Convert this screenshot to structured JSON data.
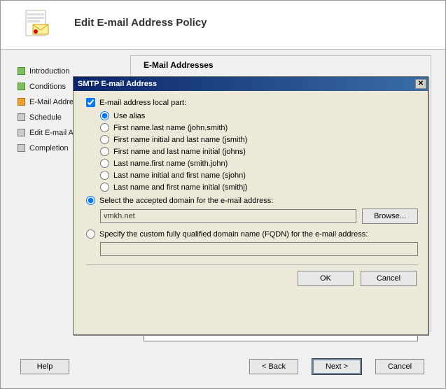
{
  "wizard": {
    "title": "Edit E-mail Address Policy",
    "section_title": "E-Mail Addresses",
    "steps": [
      {
        "label": "Introduction",
        "status": "green"
      },
      {
        "label": "Conditions",
        "status": "green"
      },
      {
        "label": "E-Mail Addresses",
        "status": "orange"
      },
      {
        "label": "Schedule",
        "status": "grey"
      },
      {
        "label": "Edit E-mail Address Policy",
        "status": "grey"
      },
      {
        "label": "Completion",
        "status": "grey"
      }
    ],
    "buttons": {
      "help": "Help",
      "back": "< Back",
      "next": "Next >",
      "cancel": "Cancel"
    }
  },
  "dialog": {
    "title": "SMTP E-mail Address",
    "checkbox_label": "E-mail address local part:",
    "checkbox_checked": true,
    "local_part_options": [
      "Use alias",
      "First name.last name (john.smith)",
      "First name initial and last name (jsmith)",
      "First name and last name initial (johns)",
      "Last name.first name (smith.john)",
      "Last name initial and first name (sjohn)",
      "Last name and first name initial (smithj)"
    ],
    "local_part_selected_index": 0,
    "domain_mode_selected": "accepted",
    "accepted_label": "Select the accepted domain for the e-mail address:",
    "accepted_value": "vmkh.net",
    "browse_label": "Browse...",
    "fqdn_label": "Specify the custom fully qualified domain name (FQDN) for the e-mail address:",
    "fqdn_value": "",
    "ok_label": "OK",
    "cancel_label": "Cancel"
  }
}
